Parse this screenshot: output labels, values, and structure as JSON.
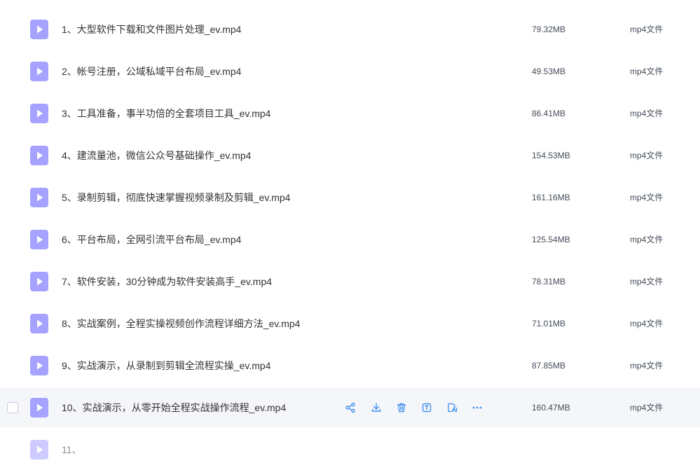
{
  "files": [
    {
      "name": "1、大型软件下载和文件图片处理_ev.mp4",
      "size": "79.32MB",
      "type": "mp4文件"
    },
    {
      "name": "2、帐号注册，公域私域平台布局_ev.mp4",
      "size": "49.53MB",
      "type": "mp4文件"
    },
    {
      "name": "3、工具准备，事半功倍的全套项目工具_ev.mp4",
      "size": "86.41MB",
      "type": "mp4文件"
    },
    {
      "name": "4、建流量池，微信公众号基础操作_ev.mp4",
      "size": "154.53MB",
      "type": "mp4文件"
    },
    {
      "name": "5、录制剪辑，彻底快速掌握视频录制及剪辑_ev.mp4",
      "size": "161.16MB",
      "type": "mp4文件"
    },
    {
      "name": "6、平台布局，全网引流平台布局_ev.mp4",
      "size": "125.54MB",
      "type": "mp4文件"
    },
    {
      "name": "7、软件安装，30分钟成为软件安装高手_ev.mp4",
      "size": "78.31MB",
      "type": "mp4文件"
    },
    {
      "name": "8、实战案例，全程实操视频创作流程详细方法_ev.mp4",
      "size": "71.01MB",
      "type": "mp4文件"
    },
    {
      "name": "9、实战演示，从录制到剪辑全流程实操_ev.mp4",
      "size": "87.85MB",
      "type": "mp4文件"
    },
    {
      "name": "10、实战演示，从零开始全程实战操作流程_ev.mp4",
      "size": "160.47MB",
      "type": "mp4文件"
    },
    {
      "name": "11、",
      "size": "",
      "type": ""
    }
  ],
  "hovered_index": 9,
  "row_actions": [
    {
      "id": "share",
      "icon": "share-icon"
    },
    {
      "id": "download",
      "icon": "download-icon"
    },
    {
      "id": "delete",
      "icon": "trash-icon"
    },
    {
      "id": "rename",
      "icon": "rename-icon"
    },
    {
      "id": "ai",
      "icon": "ai-assistant-icon"
    },
    {
      "id": "more",
      "icon": "more-icon"
    }
  ],
  "colors": {
    "icon_purple": "#a6a2ff",
    "action_blue": "#3e8ff0",
    "hover_bg": "#f5f6fa"
  }
}
